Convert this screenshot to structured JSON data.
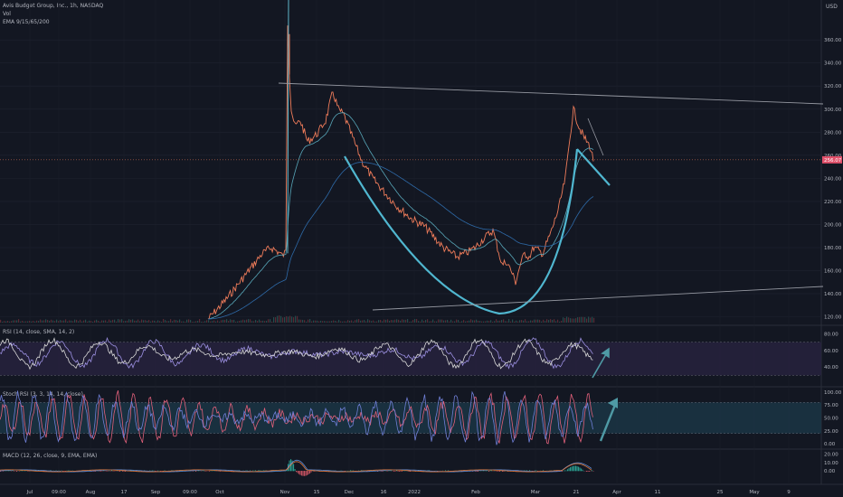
{
  "header": {
    "symbol": "Avis Budget Group, Inc., 1h, NASDAQ",
    "vol_label": "Vol",
    "ema_label": "EMA 9/15/65/200",
    "currency": "USD"
  },
  "colors": {
    "background": "#131722",
    "price": "#ef7c5a",
    "ema_fast": "#5fb6c9",
    "ema_slow": "#2e6aa8",
    "pattern": "#50b7d0",
    "trendline": "#9598a1",
    "rsi": "#9b8fe0",
    "rsi_sma": "#d8d8d8",
    "stoch_k": "#e0607a",
    "stoch_d": "#6f7fd6",
    "macd": "#5b8cd8",
    "signal": "#e07a3c",
    "hist_up": "#2fb3a0",
    "hist_down": "#e05a6a",
    "arrow": "#4f9aa5"
  },
  "chart_data": [
    {
      "type": "line",
      "title": "",
      "series": [
        {
          "name": "",
          "x": [
            0,
            40,
            80,
            130,
            170,
            200,
            215,
            230,
            250,
            265,
            280,
            290,
            300,
            308,
            312,
            316,
            318,
            320,
            322,
            326,
            332,
            340,
            350,
            360,
            368,
            374,
            380,
            390,
            400,
            412,
            425,
            440,
            455,
            470,
            490,
            505,
            515,
            525,
            535,
            545,
            550,
            555,
            560,
            565,
            570,
            575,
            580,
            585,
            590,
            600,
            610,
            618,
            625,
            630,
            634,
            640,
            646,
            652,
            656
          ],
          "y": [
            0,
            0,
            0,
            0,
            0,
            0,
            0,
            118,
            135,
            150,
            165,
            175,
            180,
            176,
            173,
            176,
            375,
            330,
            300,
            285,
            290,
            272,
            278,
            290,
            315,
            300,
            295,
            275,
            255,
            240,
            228,
            215,
            205,
            198,
            180,
            172,
            175,
            180,
            188,
            195,
            180,
            165,
            168,
            160,
            150,
            165,
            175,
            172,
            180,
            175,
            195,
            215,
            240,
            275,
            300,
            285,
            275,
            268,
            256
          ]
        }
      ],
      "yticks": [
        "360.00",
        "340.00",
        "320.00",
        "300.00",
        "280.00",
        "260.00",
        "240.00",
        "220.00",
        "200.00",
        "180.00",
        "160.00",
        "140.00",
        "120.00"
      ],
      "ylim": [
        115,
        375
      ],
      "last_price": "256.07",
      "xticks": [
        "Jul",
        "09:00",
        "Aug",
        "17",
        "Sep",
        "09:00",
        "Oct",
        "Nov",
        "15",
        "Dec",
        "16",
        "2022",
        "Feb",
        "Mar",
        "21",
        "Apr",
        "11",
        "25",
        "May",
        "9"
      ]
    },
    {
      "type": "line",
      "title": "RSI (14, close, SMA, 14, 2)",
      "yticks": [
        "80.00",
        "60.00",
        "40.00"
      ],
      "ylim": [
        25,
        88
      ],
      "band": [
        30,
        70
      ]
    },
    {
      "type": "line",
      "title": "Stoch RSI (3, 3, 14, 14, close)",
      "yticks": [
        "100.00",
        "75.00",
        "50.00",
        "25.00",
        "0.00"
      ],
      "ylim": [
        -5,
        105
      ],
      "band": [
        20,
        80
      ]
    },
    {
      "type": "bar",
      "title": "MACD (12, 26, close, 9, EMA, EMA)",
      "yticks": [
        "20.00",
        "10.00",
        "0.00"
      ],
      "ylim": [
        -12,
        24
      ]
    }
  ]
}
